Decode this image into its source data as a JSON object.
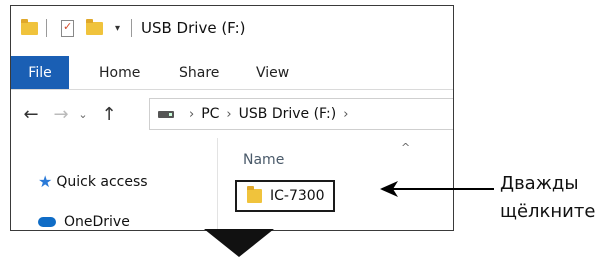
{
  "window": {
    "title": "USB Drive (F:)",
    "quick_access_dropdown": "▾"
  },
  "ribbon": {
    "tabs": [
      "File",
      "Home",
      "Share",
      "View"
    ]
  },
  "address": {
    "crumbs": [
      "PC",
      "USB Drive (F:)"
    ]
  },
  "nav_pane": {
    "quick_access": "Quick access",
    "onedrive": "OneDrive"
  },
  "content": {
    "column_name": "Name",
    "folder": "IC-7300"
  },
  "callout": {
    "line1": "Дважды",
    "line2": "щёлкните"
  },
  "colors": {
    "file_tab": "#1a5fb4",
    "folder": "#f0c33c",
    "quick_access_star": "#2a7ad8",
    "onedrive": "#0f6cc6"
  }
}
